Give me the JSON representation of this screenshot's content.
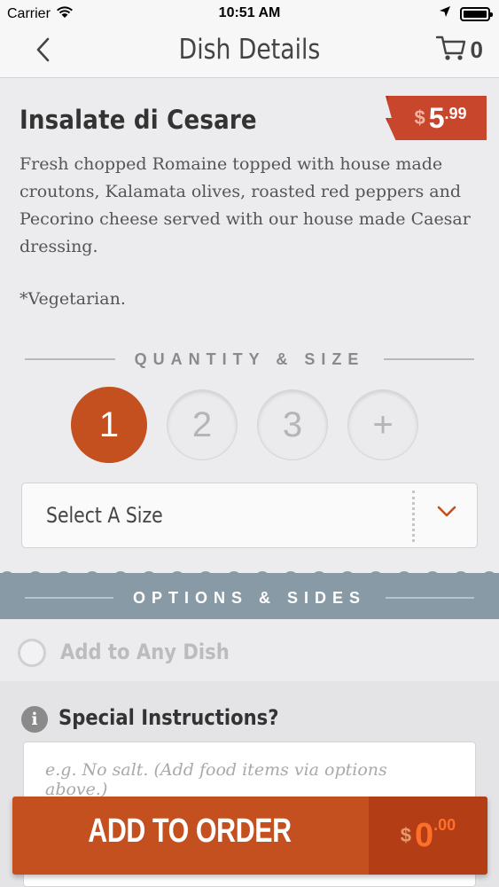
{
  "status_bar": {
    "carrier": "Carrier",
    "time": "10:51 AM"
  },
  "nav": {
    "title": "Dish Details",
    "cart_count": "0",
    "icons": [
      "chevron-left-icon",
      "cart-icon"
    ]
  },
  "dish": {
    "name": "Insalate di Cesare",
    "price": {
      "currency": "$",
      "dollars": "5",
      "cents": ".99"
    },
    "description": "Fresh chopped Romaine topped with house made croutons, Kalamata olives, roasted red peppers and Pecorino cheese served with our house made Caesar dressing.",
    "note": "*Vegetarian."
  },
  "quantity_section": {
    "heading": "QUANTITY & SIZE",
    "options": [
      "1",
      "2",
      "3",
      "+"
    ],
    "selected": "1"
  },
  "size_select": {
    "label": "Select A Size"
  },
  "options_section": {
    "heading": "OPTIONS & SIDES",
    "option_label": "Add to Any Dish"
  },
  "special_instructions": {
    "title": "Special Instructions?",
    "placeholder": "e.g. No salt. (Add food items via options above.)"
  },
  "add_to_order": {
    "label": "ADD TO ORDER",
    "currency": "$",
    "dollars": "0",
    "cents": ".00"
  },
  "colors": {
    "accent": "#c4501f",
    "price_tag": "#c8462b",
    "options_band": "#889aa6"
  }
}
